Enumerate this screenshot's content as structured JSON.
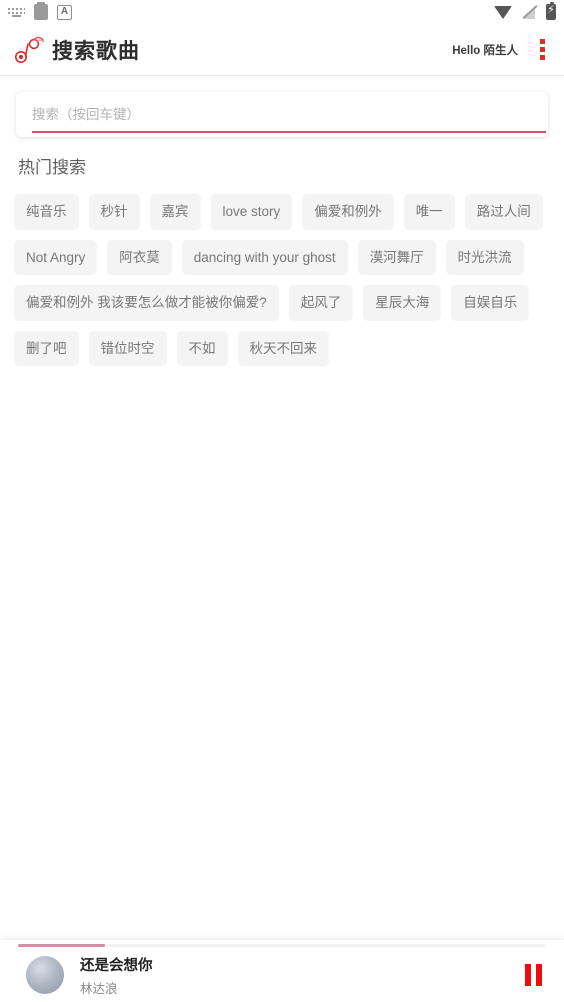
{
  "statusbar": {
    "left_icons": [
      "keyboard-icon",
      "card-icon",
      "letter-a-icon"
    ],
    "right_icons": [
      "wifi-icon",
      "signal-off-icon",
      "battery-charging-icon"
    ],
    "letter_a": "A"
  },
  "header": {
    "logo": "music-note-logo-icon",
    "title": "搜索歌曲",
    "greeting": "Hello 陌生人",
    "menu_icon": "vertical-dots-icon",
    "menu_color": "#e8292a"
  },
  "search": {
    "value": "",
    "placeholder": "搜索（按回车键）",
    "underline_color": "#dd4a74"
  },
  "hot_search": {
    "title": "热门搜索",
    "tags": [
      "纯音乐",
      "秒针",
      "嘉宾",
      "love story",
      "偏爱和例外",
      "唯一",
      "路过人间",
      "Not Angry",
      "阿衣莫",
      "dancing with your ghost",
      "漠河舞厅",
      "时光洪流",
      "偏爱和例外 我该要怎么做才能被你偏爱?",
      "起风了",
      "星辰大海",
      "自娱自乐",
      "删了吧",
      "错位时空",
      "不如",
      "秋天不回来"
    ]
  },
  "player": {
    "album_art": "album-art-circle",
    "track_title": "还是会想你",
    "artist": "林达浪",
    "control_icon": "pause-icon",
    "control_color": "#ef0d0d",
    "progress_percent": 16.5,
    "progress_fill_color": "#d98ba8"
  }
}
